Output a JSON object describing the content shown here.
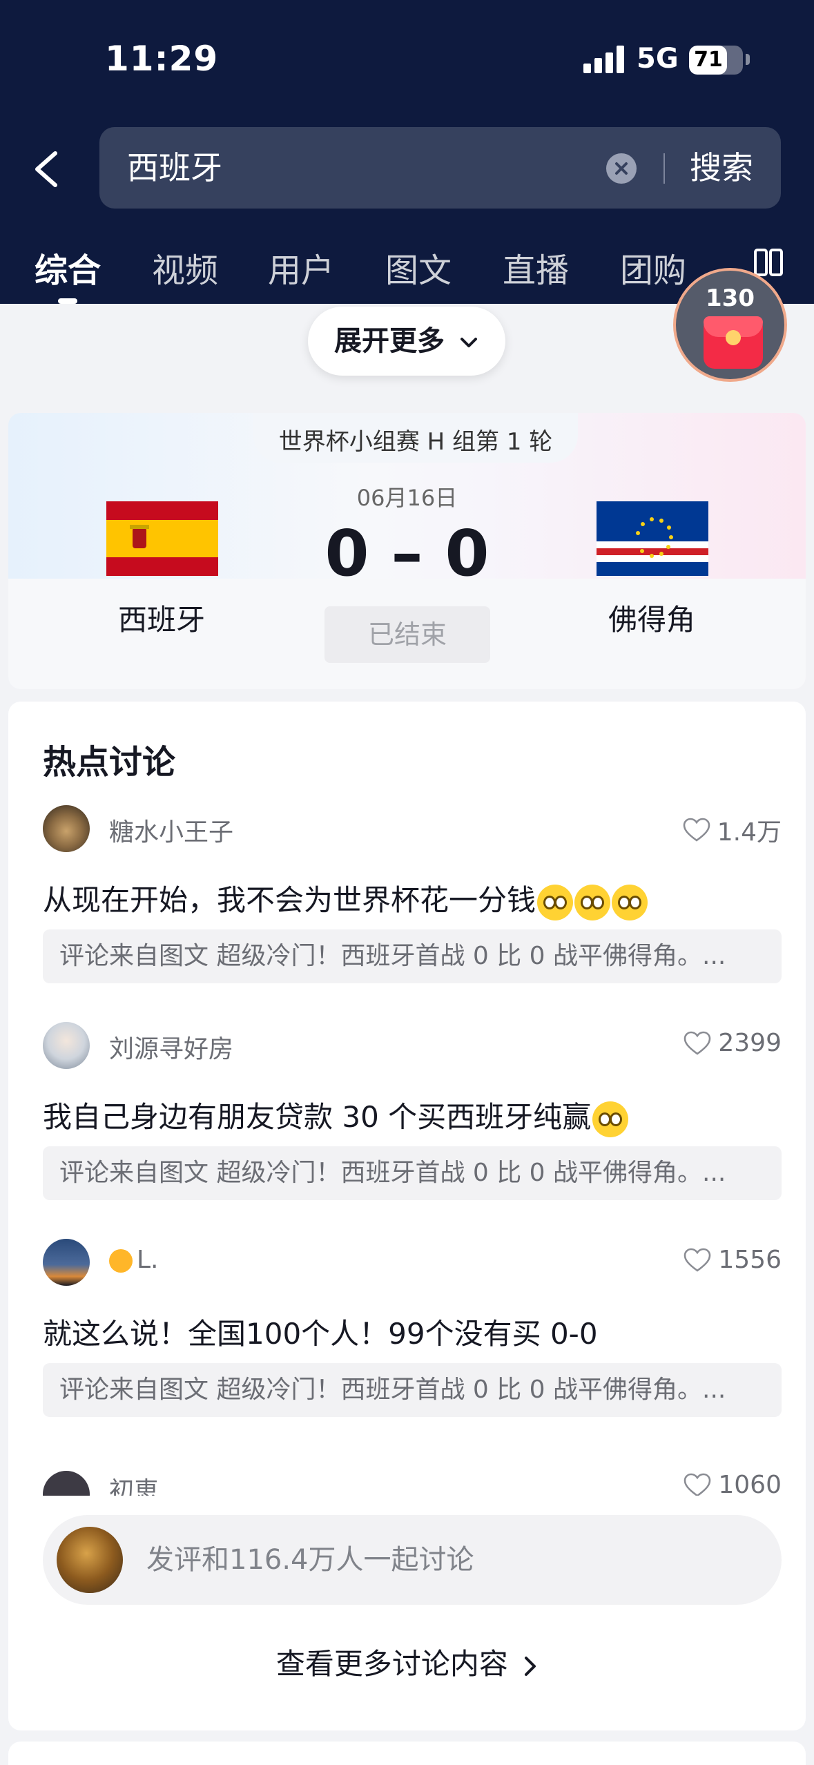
{
  "status_bar": {
    "time": "11:29",
    "network": "5G",
    "battery": "71",
    "battery_level": 0.71
  },
  "search": {
    "query": "西班牙",
    "submit_label": "搜索"
  },
  "tabs": [
    {
      "label": "综合",
      "active": true
    },
    {
      "label": "视频",
      "active": false
    },
    {
      "label": "用户",
      "active": false
    },
    {
      "label": "图文",
      "active": false
    },
    {
      "label": "直播",
      "active": false
    },
    {
      "label": "团购",
      "active": false
    }
  ],
  "red_packet": {
    "count": "130"
  },
  "expand": {
    "label": "展开更多"
  },
  "match": {
    "stage": "世界杯小组赛 H 组第 1 轮",
    "date": "06月16日",
    "score": "0 – 0",
    "status": "已结束",
    "home": {
      "name": "西班牙"
    },
    "away": {
      "name": "佛得角"
    }
  },
  "discussion": {
    "title": "热点讨论",
    "comments": [
      {
        "user": "糖水小王子",
        "likes": "1.4万",
        "text": "从现在开始，我不会为世界杯花一分钱",
        "emoji_count": 3,
        "source": "评论来自图文  超级冷门！西班牙首战 0 比 0 战平佛得角。..."
      },
      {
        "user": "刘源寻好房",
        "likes": "2399",
        "text": "我自己身边有朋友贷款 30 个买西班牙纯赢",
        "emoji_count": 1,
        "source": "评论来自图文  超级冷门！西班牙首战 0 比 0 战平佛得角。..."
      },
      {
        "user": "L.",
        "likes": "1556",
        "text": "就这么说！全国100个人！99个没有买 0-0",
        "emoji_count": 0,
        "source": "评论来自图文  超级冷门！西班牙首战 0 比 0 战平佛得角。..."
      }
    ],
    "partial_comment": {
      "user": "初恵",
      "likes": "1060"
    },
    "input_placeholder": "发评和116.4万人一起讨论",
    "more_label": "查看更多讨论内容"
  },
  "colors": {
    "header_bg": "#0e1a3e",
    "search_bg": "#36415e",
    "red_packet": "#f32b46",
    "spain_red": "#c60b1e",
    "spain_yellow": "#ffc400",
    "cv_blue": "#003893",
    "cv_red": "#cf2027"
  }
}
